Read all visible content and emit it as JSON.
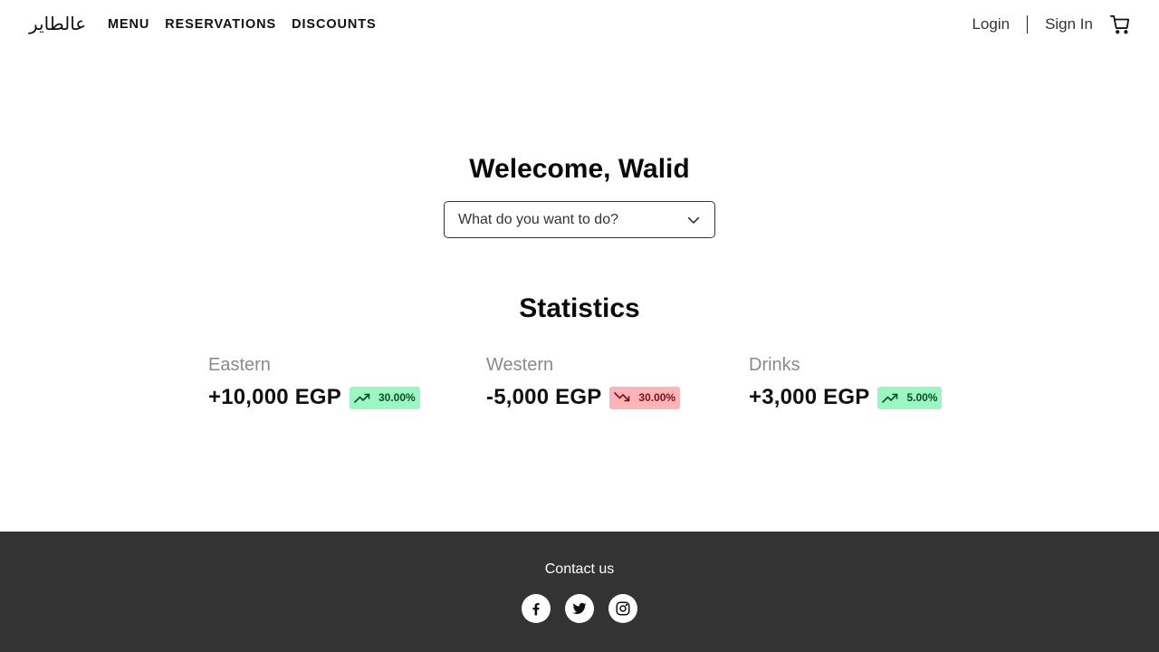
{
  "header": {
    "logo": "عالطاير",
    "nav": [
      "MENU",
      "RESERVATIONS",
      "DISCOUNTS"
    ],
    "login": "Login",
    "sign_in": "Sign In",
    "cart_icon": "cart-icon"
  },
  "main": {
    "welcome": "Welecome, Walid",
    "action_select": {
      "placeholder": "What do you want to do?",
      "icon": "chevron-down-icon"
    },
    "stats_title": "Statistics",
    "stats": [
      {
        "label": "Eastern",
        "amount": "+10,000 EGP",
        "change": "30.00%",
        "trend": "up",
        "color": "#9bf6c1"
      },
      {
        "label": "Western",
        "amount": "-5,000 EGP",
        "change": "30.00%",
        "trend": "down",
        "color": "#fbb5b9"
      },
      {
        "label": "Drinks",
        "amount": "+3,000 EGP",
        "change": "5.00%",
        "trend": "up",
        "color": "#9bf6c1"
      }
    ]
  },
  "footer": {
    "contact": "Contact us",
    "socials": [
      "facebook-icon",
      "twitter-icon",
      "instagram-icon"
    ],
    "background": "#333333"
  }
}
